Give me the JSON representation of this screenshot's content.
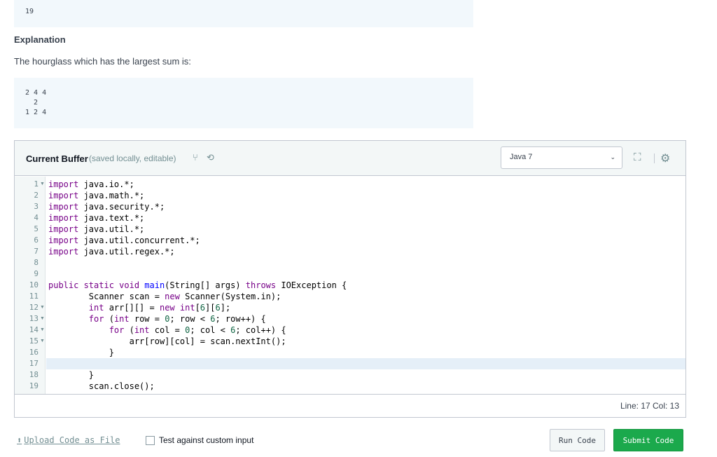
{
  "sample_output": {
    "value": "19"
  },
  "explanation": {
    "title": "Explanation",
    "text": "The hourglass which has the largest sum is:",
    "hourglass_lines": [
      "2 4 4",
      "  2",
      "1 2 4"
    ]
  },
  "editor": {
    "title": "Current Buffer",
    "subtitle": "(saved locally, editable)",
    "language": "Java 7",
    "cursor": "Line: 17 Col: 13",
    "line_numbers": [
      "1",
      "2",
      "3",
      "4",
      "5",
      "6",
      "7",
      "8",
      "9",
      "10",
      "11",
      "12",
      "13",
      "14",
      "15",
      "16",
      "17",
      "18",
      "19"
    ],
    "code": {
      "l1_kw": "import",
      "l1_rest": " java.io.*;",
      "l2_kw": "import",
      "l2_rest": " java.math.*;",
      "l3_kw": "import",
      "l3_rest": " java.security.*;",
      "l4_kw": "import",
      "l4_rest": " java.text.*;",
      "l5_kw": "import",
      "l5_rest": " java.util.*;",
      "l6_kw": "import",
      "l6_rest": " java.util.concurrent.*;",
      "l7_kw": "import",
      "l7_rest": " java.util.regex.*;",
      "l10_a": "public static void",
      "l10_def": " main",
      "l10_b": "(String[] args) ",
      "l10_kw": "throws",
      "l10_c": " IOException {",
      "l11_a": "        Scanner scan = ",
      "l11_kw": "new",
      "l11_b": " Scanner(System.in);",
      "l12_kw": "        int",
      "l12_a": " arr[][] = ",
      "l12_kw2": "new",
      "l12_kw3": " int",
      "l12_b": "[",
      "l12_n1": "6",
      "l12_c": "][",
      "l12_n2": "6",
      "l12_d": "];",
      "l13_kw": "        for",
      "l13_a": " (",
      "l13_kw2": "int",
      "l13_b": " row = ",
      "l13_n1": "0",
      "l13_c": "; row < ",
      "l13_n2": "6",
      "l13_d": "; row++) {",
      "l14_kw": "            for",
      "l14_a": " (",
      "l14_kw2": "int",
      "l14_b": " col = ",
      "l14_n1": "0",
      "l14_c": "; col < ",
      "l14_n2": "6",
      "l14_d": "; col++) {",
      "l15": "                arr[row][col] = scan.nextInt();",
      "l16": "            }",
      "l18": "        }",
      "l19": "        scan.close();"
    }
  },
  "footer": {
    "upload_label": "Upload Code as File",
    "custom_input_label": "Test against custom input",
    "run_label": "Run Code",
    "submit_label": "Submit Code"
  }
}
